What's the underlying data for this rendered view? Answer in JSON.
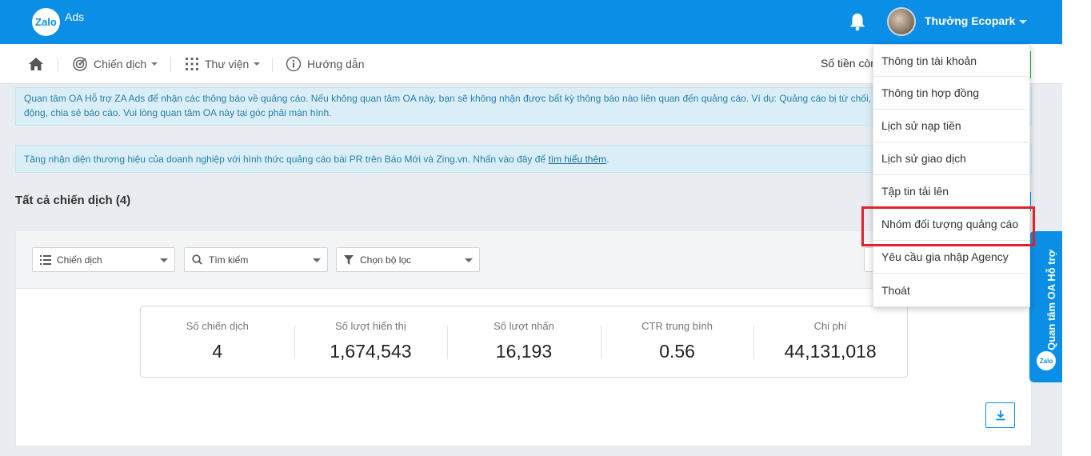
{
  "header": {
    "logo_badge": "Zalo",
    "logo_text": "Ads",
    "username": "Thưởng Ecopark",
    "bell_icon": "bell-icon"
  },
  "nav": {
    "home_icon": "home-icon",
    "campaign_label": "Chiến dịch",
    "library_label": "Thư viện",
    "guide_label": "Hướng dẫn",
    "balance_label": "Số tiền còn"
  },
  "alerts": {
    "oa_notice": "Quan tâm OA Hỗ trợ ZA Ads để nhận các thông báo về quảng cáo. Nếu không quan tâm OA này, bạn sẽ không nhận được bất kỳ thông báo nào liên quan đến quảng cáo. Ví dụ: Quảng cáo bị từ chối, đ",
    "oa_notice_line2": "động, chia sẻ báo cáo. Vui lòng quan tâm OA này tại góc phải màn hình.",
    "pr_notice": "Tăng nhận diện thương hiệu của doanh nghiệp với hình thức quảng cáo bài PR trên Báo Mới và Zing.vn. Nhấn vào đây để ",
    "pr_link": "tìm hiểu thêm",
    "pr_suffix": "."
  },
  "section": {
    "title": "Tất cả chiến dịch (4)"
  },
  "filters": {
    "campaign_select": "Chiến dịch",
    "search_select": "Tìm kiếm",
    "filter_select": "Chọn bộ lọc"
  },
  "stats": [
    {
      "label": "Số chiến dịch",
      "value": "4"
    },
    {
      "label": "Số lượt hiển thị",
      "value": "1,674,543"
    },
    {
      "label": "Số lượt nhấn",
      "value": "16,193"
    },
    {
      "label": "CTR trung bình",
      "value": "0.56"
    },
    {
      "label": "Chi phí",
      "value": "44,131,018"
    }
  ],
  "user_menu": {
    "items": [
      "Thông tin tài khoản",
      "Thông tin hợp đồng",
      "Lịch sử nạp tiền",
      "Lịch sử giao dịch",
      "Tập tin tải lên",
      "Nhóm đối tượng quảng cáo",
      "Yêu cầu gia nhập Agency",
      "Thoát"
    ],
    "highlighted_index": 5,
    "highlight_color": "#e0232a"
  },
  "oa_tab": {
    "label": "Quan tâm OA Hỗ trợ",
    "logo": "Zalo"
  },
  "colors": {
    "brand_blue": "#0a8ee6",
    "alert_bg": "#d9eef7",
    "alert_text": "#2a7ea8"
  }
}
